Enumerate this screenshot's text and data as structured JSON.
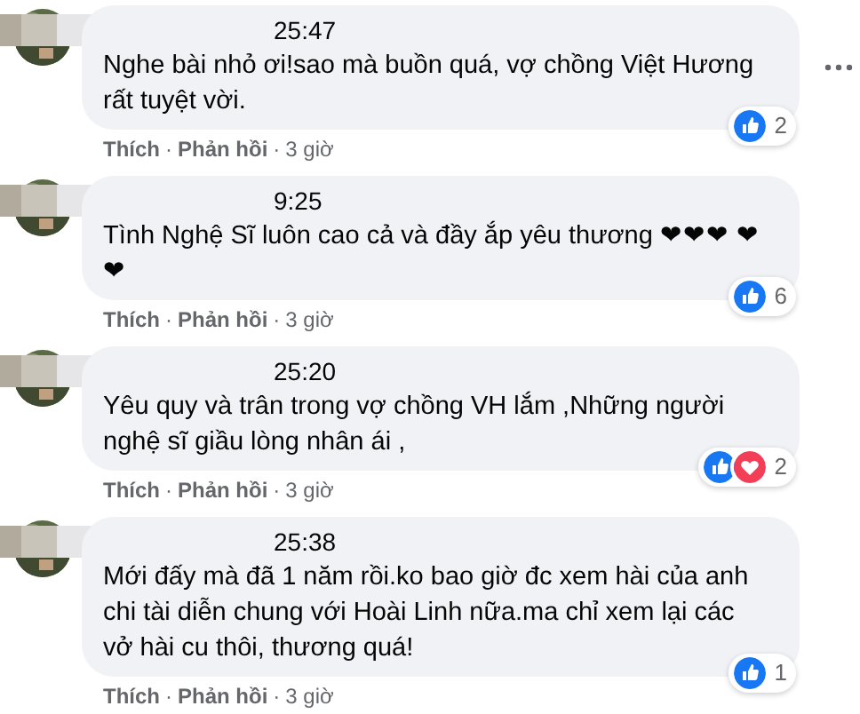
{
  "comments": [
    {
      "time": "25:47",
      "text": "Nghe bài nhỏ ơi!sao mà buồn quá, vợ chồng Việt Hương rất tuyệt vời.",
      "menu_visible": true,
      "actions": [
        {
          "kind": "link",
          "text": "Thích"
        },
        {
          "kind": "separator",
          "text": "·"
        },
        {
          "kind": "link",
          "text": "Phản hồi"
        },
        {
          "kind": "separator",
          "text": "·"
        },
        {
          "kind": "age",
          "text": "3 giờ"
        }
      ],
      "reactions": [
        {
          "kind": "like"
        }
      ],
      "reaction_count": "2"
    },
    {
      "time": "9:25",
      "text": "Tình Nghệ Sĩ luôn cao cả và đầy ắp yêu thương ❤❤❤ ❤❤",
      "menu_visible": false,
      "actions": [
        {
          "kind": "link",
          "text": "Thích"
        },
        {
          "kind": "separator",
          "text": "·"
        },
        {
          "kind": "link",
          "text": "Phản hồi"
        },
        {
          "kind": "separator",
          "text": "·"
        },
        {
          "kind": "age",
          "text": "3 giờ"
        }
      ],
      "reactions": [
        {
          "kind": "like"
        }
      ],
      "reaction_count": "6"
    },
    {
      "time": "25:20",
      "text": "Yêu quy và trân trong vợ chồng VH lắm ,Những người nghệ sĩ giầu lòng nhân ái ,",
      "menu_visible": false,
      "actions": [
        {
          "kind": "link",
          "text": "Thích"
        },
        {
          "kind": "separator",
          "text": "·"
        },
        {
          "kind": "link",
          "text": "Phản hồi"
        },
        {
          "kind": "separator",
          "text": "·"
        },
        {
          "kind": "age",
          "text": "3 giờ"
        }
      ],
      "reactions": [
        {
          "kind": "like"
        },
        {
          "kind": "love"
        }
      ],
      "reaction_count": "2"
    },
    {
      "time": "25:38",
      "text": "Mới đấy mà đã 1 năm rồi.ko bao giờ đc xem hài của anh chi tài diễn chung với Hoài Linh nữa.ma chỉ xem lại các vở hài cu thôi, thương quá!",
      "menu_visible": false,
      "actions": [
        {
          "kind": "link",
          "text": "Thích"
        },
        {
          "kind": "separator",
          "text": "·"
        },
        {
          "kind": "link",
          "text": "Phản hồi"
        },
        {
          "kind": "separator",
          "text": "·"
        },
        {
          "kind": "age",
          "text": "3 giờ"
        }
      ],
      "reactions": [
        {
          "kind": "like"
        }
      ],
      "reaction_count": "1"
    }
  ]
}
